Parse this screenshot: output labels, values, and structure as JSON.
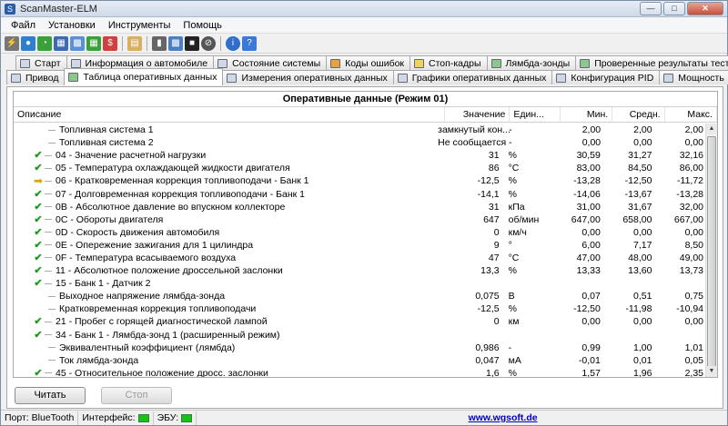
{
  "window": {
    "title": "ScanMaster-ELM"
  },
  "menu": [
    "Файл",
    "Установки",
    "Инструменты",
    "Помощь"
  ],
  "tabs_row1": [
    "Старт",
    "Информация о автомобиле",
    "Состояние системы",
    "Коды ошибок",
    "Стоп-кадры",
    "Лямбда-зонды",
    "Проверенные результаты теста"
  ],
  "tabs_row2": [
    "Привод",
    "Таблица оперативных данных",
    "Измерения оперативных данных",
    "Графики оперативных данных",
    "Конфигурация PID",
    "Мощность"
  ],
  "active_tab": "Таблица оперативных данных",
  "grid": {
    "title": "Оперативные данные (Режим 01)",
    "columns": {
      "desc": "Описание",
      "value": "Значение",
      "unit": "Един...",
      "min": "Мин.",
      "avg": "Средн.",
      "max": "Макс."
    },
    "rows": [
      {
        "mark": "",
        "indent": 1,
        "desc": "Топливная система 1",
        "value": "замкнутый кон...",
        "unit": "-",
        "min": "2,00",
        "avg": "2,00",
        "max": "2,00"
      },
      {
        "mark": "",
        "indent": 1,
        "desc": "Топливная система 2",
        "value": "Не сообщается",
        "unit": "-",
        "min": "0,00",
        "avg": "0,00",
        "max": "0,00"
      },
      {
        "mark": "check",
        "indent": 0,
        "desc": "04 - Значение расчетной нагрузки",
        "value": "31",
        "unit": "%",
        "min": "30,59",
        "avg": "31,27",
        "max": "32,16"
      },
      {
        "mark": "check",
        "indent": 0,
        "desc": "05 - Температура охлаждающей жидкости двигателя",
        "value": "86",
        "unit": "°C",
        "min": "83,00",
        "avg": "84,50",
        "max": "86,00"
      },
      {
        "mark": "arrow",
        "indent": 0,
        "desc": "06 - Кратковременная коррекция топливоподачи - Банк 1",
        "value": "-12,5",
        "unit": "%",
        "min": "-13,28",
        "avg": "-12,50",
        "max": "-11,72"
      },
      {
        "mark": "check",
        "indent": 0,
        "desc": "07 - Долговременная коррекция топливоподачи - Банк 1",
        "value": "-14,1",
        "unit": "%",
        "min": "-14,06",
        "avg": "-13,67",
        "max": "-13,28"
      },
      {
        "mark": "check",
        "indent": 0,
        "desc": "0B - Абсолютное давление во впускном коллекторе",
        "value": "31",
        "unit": "кПа",
        "min": "31,00",
        "avg": "31,67",
        "max": "32,00"
      },
      {
        "mark": "check",
        "indent": 0,
        "desc": "0C - Обороты двигателя",
        "value": "647",
        "unit": "об/мин",
        "min": "647,00",
        "avg": "658,00",
        "max": "667,00"
      },
      {
        "mark": "check",
        "indent": 0,
        "desc": "0D - Скорость движения автомобиля",
        "value": "0",
        "unit": "км/ч",
        "min": "0,00",
        "avg": "0,00",
        "max": "0,00"
      },
      {
        "mark": "check",
        "indent": 0,
        "desc": "0E - Опережение зажигания для 1 цилиндра",
        "value": "9",
        "unit": "°",
        "min": "6,00",
        "avg": "7,17",
        "max": "8,50"
      },
      {
        "mark": "check",
        "indent": 0,
        "desc": "0F - Температура всасываемого воздуха",
        "value": "47",
        "unit": "°C",
        "min": "47,00",
        "avg": "48,00",
        "max": "49,00"
      },
      {
        "mark": "check",
        "indent": 0,
        "desc": "11 - Абсолютное положение дроссельной заслонки",
        "value": "13,3",
        "unit": "%",
        "min": "13,33",
        "avg": "13,60",
        "max": "13,73"
      },
      {
        "mark": "check",
        "indent": 0,
        "desc": "15 - Банк 1 - Датчик 2",
        "value": "",
        "unit": "",
        "min": "",
        "avg": "",
        "max": ""
      },
      {
        "mark": "",
        "indent": 1,
        "desc": "Выходное напряжение лямбда-зонда",
        "value": "0,075",
        "unit": "В",
        "min": "0,07",
        "avg": "0,51",
        "max": "0,75"
      },
      {
        "mark": "",
        "indent": 1,
        "desc": "Кратковременная коррекция топливоподачи",
        "value": "-12,5",
        "unit": "%",
        "min": "-12,50",
        "avg": "-11,98",
        "max": "-10,94"
      },
      {
        "mark": "check",
        "indent": 0,
        "desc": "21 - Пробег с горящей диагностической лампой",
        "value": "0",
        "unit": "км",
        "min": "0,00",
        "avg": "0,00",
        "max": "0,00"
      },
      {
        "mark": "check",
        "indent": 0,
        "desc": "34 - Банк 1 - Лямбда-зонд 1 (расширенный режим)",
        "value": "",
        "unit": "",
        "min": "",
        "avg": "",
        "max": ""
      },
      {
        "mark": "",
        "indent": 1,
        "desc": "Эквивалентный коэффициент (лямбда)",
        "value": "0,986",
        "unit": "-",
        "min": "0,99",
        "avg": "1,00",
        "max": "1,01"
      },
      {
        "mark": "",
        "indent": 1,
        "desc": "Ток лямбда-зонда",
        "value": "0,047",
        "unit": "мА",
        "min": "-0,01",
        "avg": "0,01",
        "max": "0,05"
      },
      {
        "mark": "check",
        "indent": 0,
        "desc": "45 - Относительное положение дросс. заслонки",
        "value": "1,6",
        "unit": "%",
        "min": "1,57",
        "avg": "1,96",
        "max": "2,35"
      }
    ]
  },
  "buttons": {
    "read": "Читать",
    "stop": "Стоп"
  },
  "status": {
    "port_label": "Порт:",
    "port_value": "BlueTooth",
    "interface_label": "Интерфейс:",
    "ecu_label": "ЭБУ:",
    "url": "www.wgsoft.de",
    "led_color": "#19c219"
  }
}
